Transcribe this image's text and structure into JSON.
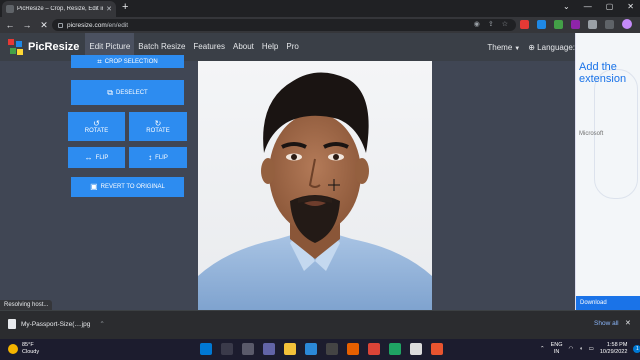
{
  "browser": {
    "tab_title": "PicResize – Crop, Resize, Edit im…",
    "url_prefix": "picresize.com",
    "url_path": "/en/edit",
    "status_text": "Resolving host..."
  },
  "site": {
    "logo_text": "PicResize",
    "nav": [
      "Edit Picture",
      "Batch Resize",
      "Features",
      "About",
      "Help",
      "Pro"
    ],
    "theme_label": "Theme",
    "language_label": "Language:"
  },
  "tools": {
    "crop_selection": "CROP SELECTION",
    "deselect": "DESELECT",
    "rotate_left": "ROTATE",
    "rotate_right": "ROTATE",
    "flip_h": "FLIP",
    "flip_v": "FLIP",
    "revert": "REVERT TO ORIGINAL"
  },
  "ad": {
    "headline": "Add the extension",
    "brand": "Microsoft",
    "download": "Download"
  },
  "downloads": {
    "file_name": "My-Passport-Size(....jpg",
    "show_all": "Show all"
  },
  "taskbar": {
    "temperature": "85°F",
    "weather": "Cloudy",
    "lang_line1": "ENG",
    "lang_line2": "IN",
    "time": "1:58 PM",
    "date": "10/29/2022",
    "notifications": "1"
  },
  "colors": {
    "accent_button": "#2d8cf0",
    "page_bg": "#404654",
    "header_bg": "#3a3f47"
  }
}
